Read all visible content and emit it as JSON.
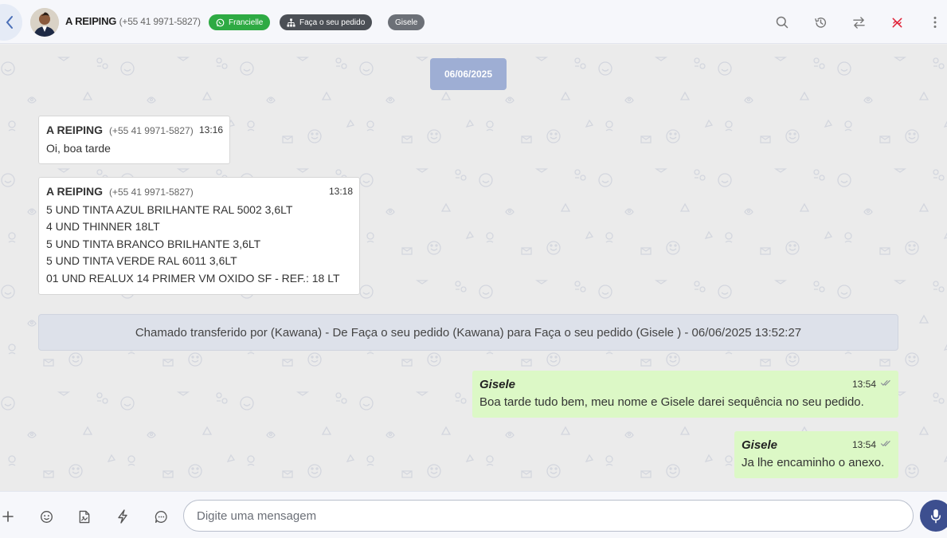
{
  "header": {
    "contact_name": "A REIPING",
    "contact_phone": "(+55 41 9971-5827)",
    "tags": [
      {
        "label": "Francielle",
        "color": "#2eaa43",
        "icon": "whatsapp-icon"
      },
      {
        "label": "Faça o seu pedido",
        "color": "#4b4f55",
        "icon": "sitemap-icon"
      },
      {
        "label": "Gisele",
        "color": "#6c7077"
      }
    ],
    "actions": [
      "search-icon",
      "history-icon",
      "transfer-icon",
      "close-ticket-icon",
      "more-vert-icon"
    ]
  },
  "chat": {
    "date": "06/06/2025",
    "messages": [
      {
        "direction": "in",
        "sender": "A REIPING",
        "phone": "(+55 41 9971-5827)",
        "time": "13:16",
        "lines": [
          "Oi, boa tarde"
        ]
      },
      {
        "direction": "in",
        "sender": "A REIPING",
        "phone": "(+55 41 9971-5827)",
        "time": "13:18",
        "lines": [
          "5 UND TINTA AZUL BRILHANTE RAL 5002 3,6LT",
          "4 UND THINNER 18LT",
          "5 UND TINTA BRANCO BRILHANTE 3,6LT",
          "5 UND TINTA VERDE RAL 6011 3,6LT",
          "01 UND REALUX 14 PRIMER VM OXIDO SF - REF.: 18 LT"
        ]
      },
      {
        "direction": "out",
        "sender": "Gisele",
        "time": "13:54",
        "lines": [
          "Boa tarde tudo bem, meu nome e Gisele darei sequência no seu pedido."
        ]
      },
      {
        "direction": "out",
        "sender": "Gisele",
        "time": "13:54",
        "lines": [
          "Ja lhe encaminho o anexo."
        ]
      }
    ],
    "system_message": "Chamado transferido por (Kawana) - De Faça o seu pedido (Kawana) para Faça o seu pedido (Gisele ) - 06/06/2025 13:52:27"
  },
  "footer": {
    "input_placeholder": "Digite uma mensagem",
    "input_value": "",
    "icons": [
      "plus-icon",
      "emoji-icon",
      "file-icon",
      "quick-reply-icon",
      "chat-bubble-icon",
      "mic-icon"
    ]
  },
  "colors": {
    "accent": "#3d4f8f",
    "outgoing_bubble": "#dcf8c6",
    "date_chip": "#9eaed4",
    "tag_green": "#2eaa43",
    "close_icon": "#e0253a"
  }
}
